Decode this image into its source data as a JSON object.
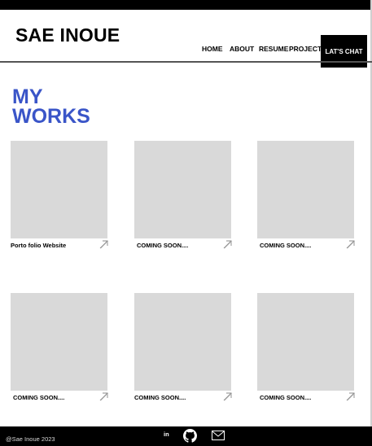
{
  "header": {
    "brand": "SAE INOUE",
    "nav": [
      "HOME",
      "ABOUT",
      "RESUME",
      "PROJECT"
    ],
    "cta_label": "LAT'S CHAT"
  },
  "section": {
    "title_line1": "MY",
    "title_line2": "WORKS"
  },
  "works": [
    {
      "label": "Porto folio Website"
    },
    {
      "label": "COMING SOON...."
    },
    {
      "label": "COMING SOON...."
    },
    {
      "label": "COMING SOON...."
    },
    {
      "label": "COMING SOON...."
    },
    {
      "label": "COMING SOON...."
    }
  ],
  "footer": {
    "copyright": "@Sae Inoue 2023",
    "linkedin_label": "in",
    "icons": [
      "linkedin-icon",
      "github-icon",
      "mail-icon"
    ]
  },
  "colors": {
    "accent": "#3a55c8",
    "placeholder": "#d9d9d9",
    "bar": "#000000"
  }
}
